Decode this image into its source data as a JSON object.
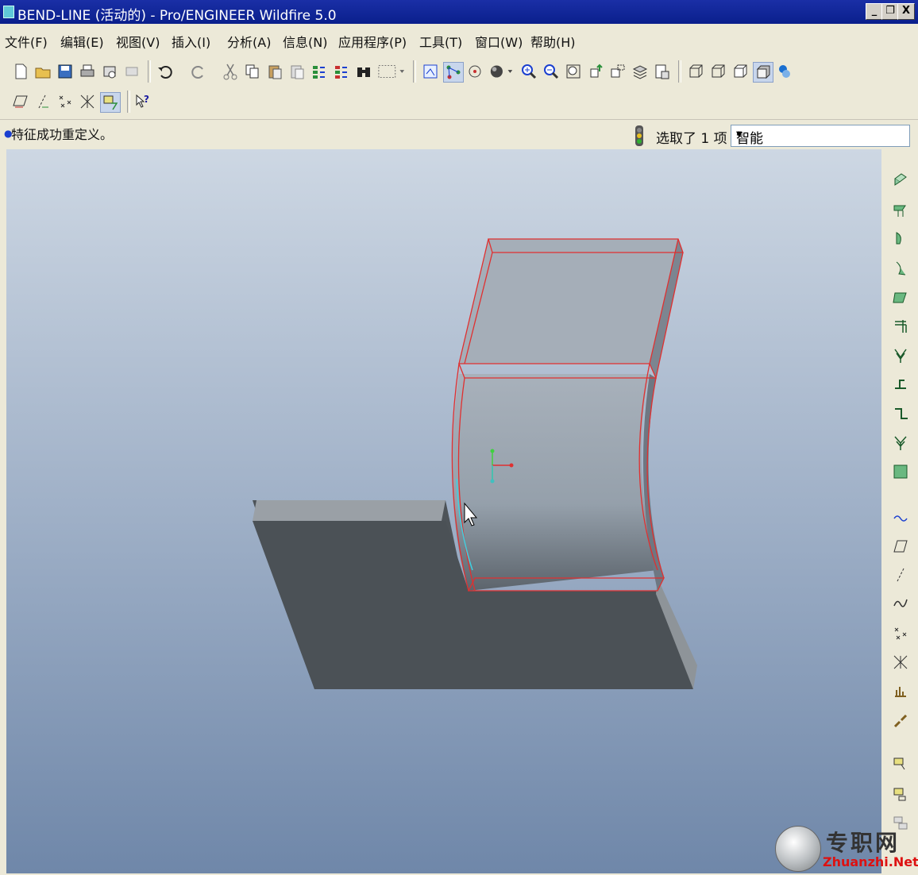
{
  "window": {
    "title": "BEND-LINE (活动的) - Pro/ENGINEER Wildfire 5.0",
    "controls": [
      "_",
      "❐",
      "X"
    ]
  },
  "menu": [
    "文件(F)",
    "编辑(E)",
    "视图(V)",
    "插入(I)",
    "分析(A)",
    "信息(N)",
    "应用程序(P)",
    "工具(T)",
    "窗口(W)",
    "帮助(H)"
  ],
  "toolbar_icons_row1": [
    "new-icon",
    "open-icon",
    "save-icon",
    "print-icon",
    "send-icon",
    "erase-icon",
    "undo-icon",
    "redo-icon",
    "cut-icon",
    "copy-icon",
    "paste-icon",
    "paste-special-icon",
    "regenerate-icon",
    "regenerate-manager-icon",
    "find-icon",
    "select-box-icon",
    "named-view-icon",
    "datum-display-icon",
    "spin-center-icon",
    "shading-icon",
    "zoom-in-icon",
    "zoom-out-icon",
    "refit-icon",
    "reorient-icon",
    "view-manager-icon",
    "layer-icon",
    "setup-icon",
    "wireframe-icon",
    "hidden-line-icon",
    "no-hidden-icon",
    "shaded-icon",
    "appearance-icon"
  ],
  "toolbar_icons_row2": [
    "datum-plane-display-icon",
    "datum-axis-display-icon",
    "datum-point-display-icon",
    "csys-display-icon",
    "annotation-display-icon",
    "context-help-icon"
  ],
  "status": {
    "message": "特征成功重定义。",
    "selection": "选取了 1 项",
    "filter_value": "智能"
  },
  "right_toolbar_icons": [
    "unbend-icon",
    "flat-wall-icon",
    "flange-icon",
    "unattached-wall-icon",
    "extrude-wall-icon",
    "rip-icon",
    "bend-icon",
    "edge-bend-icon",
    "unbend-feature-icon",
    "bend-back-icon",
    "flatten-form-icon",
    "sketch-icon",
    "plane-icon",
    "axis-icon",
    "curve-icon",
    "point-icon",
    "csys-icon",
    "analysis-icon",
    "chain-icon",
    "note-icon",
    "symbol-icon",
    "layer-tree-icon"
  ],
  "watermark": {
    "cn": "专职网",
    "en": "Zhuanzhi.Net"
  },
  "colors": {
    "title_bar": "#0a1f8c",
    "viewport_top": "#cdd7e3",
    "viewport_bottom": "#6f87a9",
    "edge_highlight": "#e03030"
  }
}
